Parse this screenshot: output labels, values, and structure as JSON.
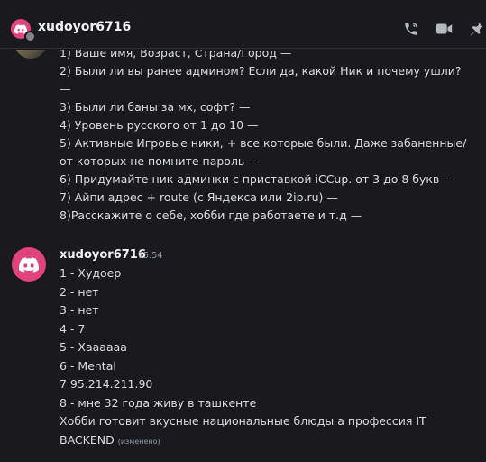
{
  "header": {
    "title": "xudoyor6716",
    "icons": [
      "discord-icon",
      "phone-call-icon",
      "video-camera-icon",
      "pin-icon"
    ]
  },
  "previous_message": {
    "lines": [
      "1) Ваше имя, Возраст, Страна/Город —",
      "2) Были ли вы ранее админом? Если да, какой Ник и почему ушли?",
      "—",
      "3) Были ли баны за мх, софт? —",
      "4) Уровень русского от 1 до 10 —",
      "5) Активные Игровые ники, + все которые были. Даже забаненные/",
      "от которых не помните пароль —",
      "6) Придумайте ник админки с приставкой iCCup. от 3 до 8 букв —",
      "7) Айпи адрес + route (с Яндекса или 2ip.ru) —",
      "8)Расскажите о себе, хобби где работаете и т.д —"
    ]
  },
  "message": {
    "author": "xudoyor6716",
    "time": "15:54",
    "lines": [
      "1 - Худоер",
      "2  - нет",
      "3  - нет",
      "4 - 7",
      "5 - Хаааааа",
      "6 -  Mental",
      "7 95.214.211.90",
      "8 - мне 32 года живу в ташкенте",
      "Хобби готовит вкусные национальные блюды а профессия IT"
    ],
    "last_line": "BACKEND",
    "edited_label": "(изменено)"
  },
  "colors": {
    "accent": "#e0447b",
    "background": "#1a1a1e",
    "text": "#dbdee1"
  }
}
